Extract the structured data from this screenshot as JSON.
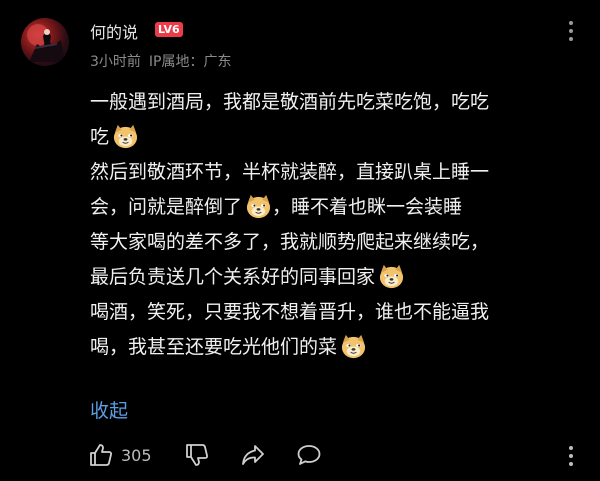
{
  "comment": {
    "username": "何的说",
    "level_badge": "LV6",
    "time": "3小时前",
    "location": "IP属地：广东",
    "lines": [
      {
        "text": "一般遇到酒局，我都是敬酒前先吃菜吃饱，吃吃",
        "emoji": false
      },
      {
        "text": "吃",
        "emoji": true
      },
      {
        "text": "然后到敬酒环节，半杯就装醉，直接趴桌上睡一",
        "emoji": false
      },
      {
        "text": "会，问就是醉倒了",
        "emoji": true,
        "after": "，睡不着也眯一会装睡"
      },
      {
        "text": "等大家喝的差不多了，我就顺势爬起来继续吃，",
        "emoji": false
      },
      {
        "text": "最后负责送几个关系好的同事回家",
        "emoji": true
      },
      {
        "text": "喝酒，笑死，只要我不想着晋升，谁也不能逼我",
        "emoji": false
      },
      {
        "text": "喝，我甚至还要吃光他们的菜",
        "emoji": true
      }
    ],
    "collapse_label": "收起",
    "like_count": "305"
  },
  "icons": {
    "emoji": "doge-emoji-icon",
    "like": "thumbs-up-icon",
    "dislike": "thumbs-down-icon",
    "share": "share-icon",
    "reply": "comment-icon",
    "more": "more-vertical-icon"
  },
  "colors": {
    "background": "#000000",
    "level_badge": "#ee3b48",
    "collapse_link": "#5b9fe6",
    "meta_text": "#8a8a8a"
  }
}
